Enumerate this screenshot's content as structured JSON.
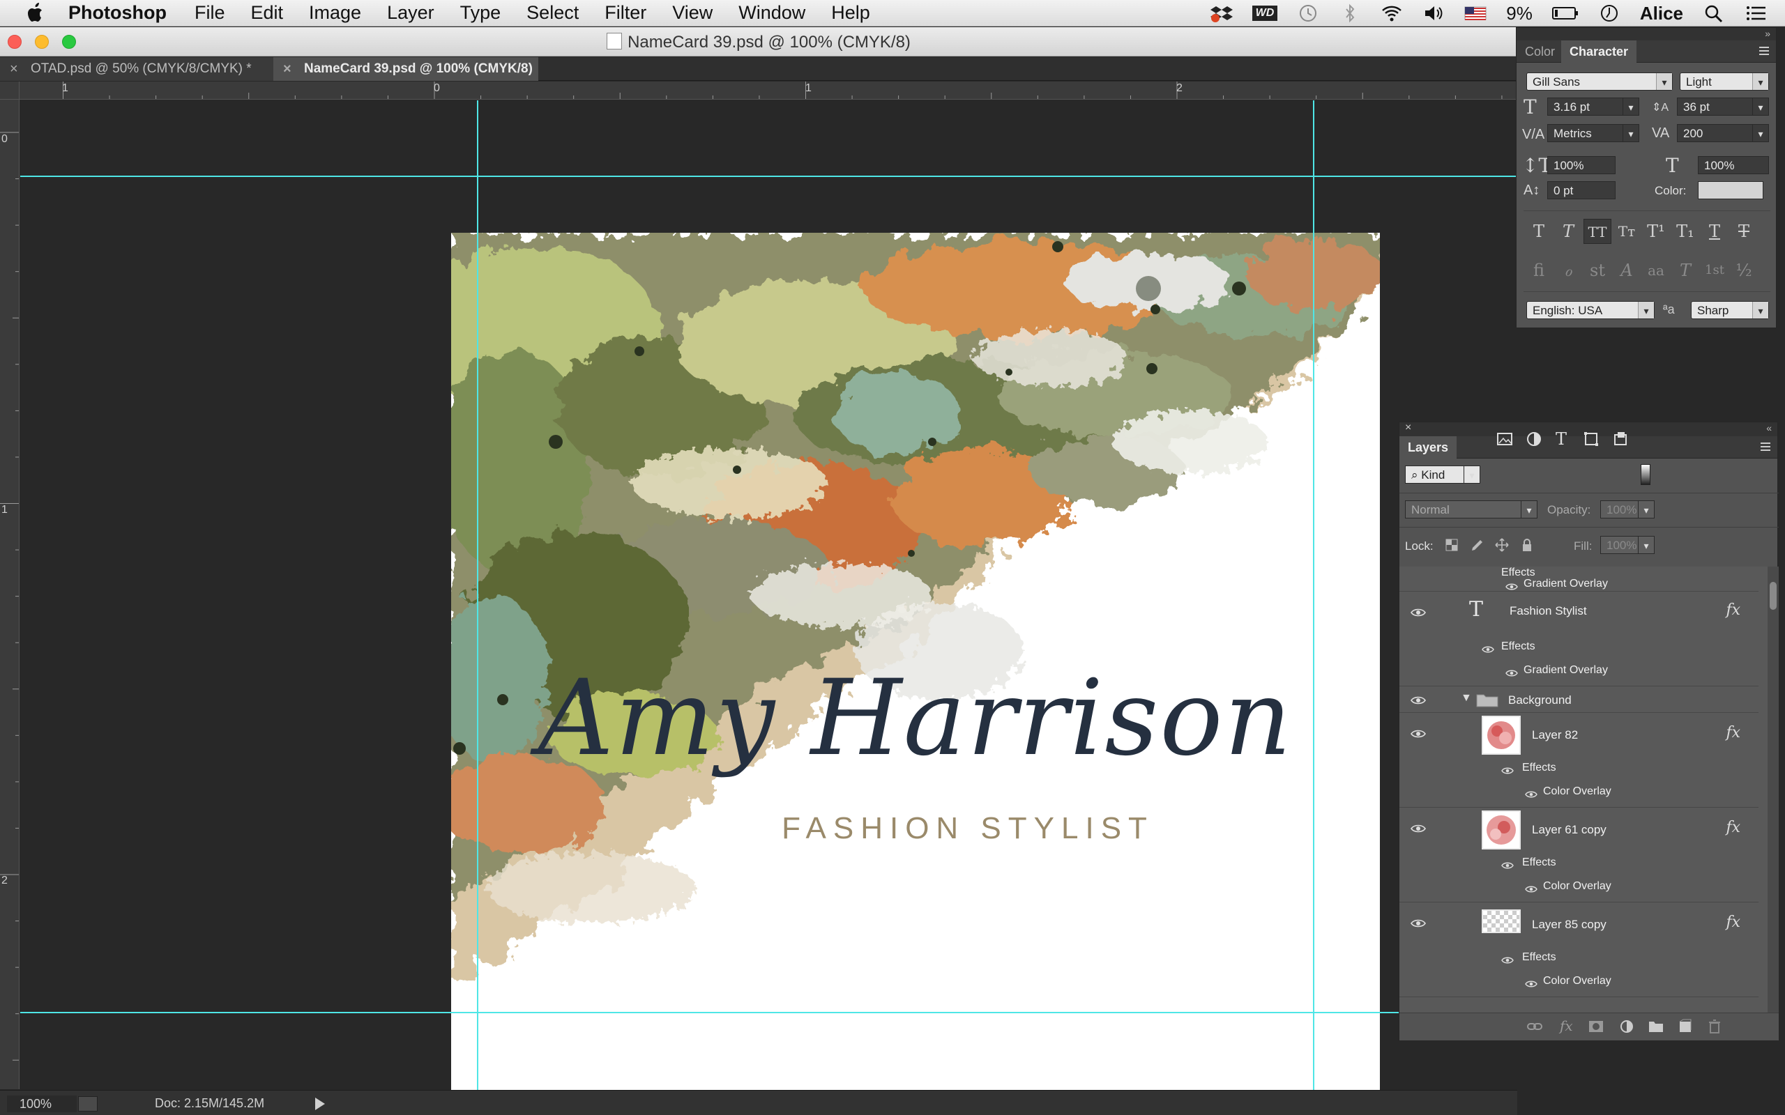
{
  "menubar": {
    "app_name": "Photoshop",
    "items": [
      "File",
      "Edit",
      "Image",
      "Layer",
      "Type",
      "Select",
      "Filter",
      "View",
      "Window",
      "Help"
    ],
    "battery_percent": "9%",
    "user_name": "Alice",
    "status_icons": [
      "dropbox-icon",
      "wd-icon",
      "time-machine-icon",
      "bluetooth-icon",
      "wifi-icon",
      "volume-icon",
      "us-flag-icon",
      "battery-icon",
      "clock-icon",
      "spotlight-icon",
      "notification-center-icon"
    ],
    "wd_label": "WD"
  },
  "window": {
    "title": "NameCard 39.psd @ 100% (CMYK/8)"
  },
  "tabs": [
    {
      "label": "OTAD.psd @ 50% (CMYK/8/CMYK) *",
      "active": false
    },
    {
      "label": "NameCard 39.psd @ 100% (CMYK/8)",
      "active": true
    }
  ],
  "rulers": {
    "horizontal_labels": [
      "1",
      "0",
      "1",
      "2"
    ],
    "vertical_labels": [
      "0",
      "1",
      "2"
    ]
  },
  "document": {
    "name_text": "Amy Harrison",
    "subtitle_text": "FASHION STYLIST",
    "name_color": "#253040",
    "subtitle_color": "#9a8a6a",
    "guide_color": "#4fe6e6"
  },
  "status": {
    "zoom": "100%",
    "doc_info": "Doc: 2.15M/145.2M"
  },
  "character_panel": {
    "tabs": [
      "Color",
      "Character"
    ],
    "active_tab": "Character",
    "font_family": "Gill Sans",
    "font_style": "Light",
    "font_size": "3.16 pt",
    "leading": "36 pt",
    "kerning": "Metrics",
    "tracking": "200",
    "vertical_scale": "100%",
    "horizontal_scale": "100%",
    "baseline_shift": "0 pt",
    "color_label": "Color:",
    "color_swatch": "#d4d4d4",
    "language": "English: USA",
    "antialias_symbol": "ªa",
    "antialias": "Sharp",
    "type_style_buttons": [
      "T",
      "T",
      "TT",
      "Tт",
      "T¹",
      "T₁",
      "T",
      "T"
    ],
    "opentype_buttons": [
      "fi",
      "ℴ",
      "st",
      "A",
      "aa",
      "T",
      "1st",
      "½"
    ]
  },
  "layers_panel": {
    "title": "Layers",
    "filter_kind": "Kind",
    "blend_mode": "Normal",
    "opacity_label": "Opacity:",
    "opacity_value": "100%",
    "lock_label": "Lock:",
    "fill_label": "Fill:",
    "fill_value": "100%",
    "fx_label": "fx",
    "rows": {
      "top_effects": "Effects",
      "top_gradient": "Gradient Overlay",
      "fashion_layer": "Fashion Stylist",
      "fashion_effects": "Effects",
      "fashion_gradient": "Gradient Overlay",
      "group_name": "Background",
      "layer82": "Layer 82",
      "layer82_effects": "Effects",
      "layer82_overlay": "Color Overlay",
      "layer61": "Layer 61 copy",
      "layer61_effects": "Effects",
      "layer61_overlay": "Color Overlay",
      "layer85": "Layer 85 copy",
      "layer85_effects": "Effects",
      "layer85_overlay": "Color Overlay"
    }
  }
}
